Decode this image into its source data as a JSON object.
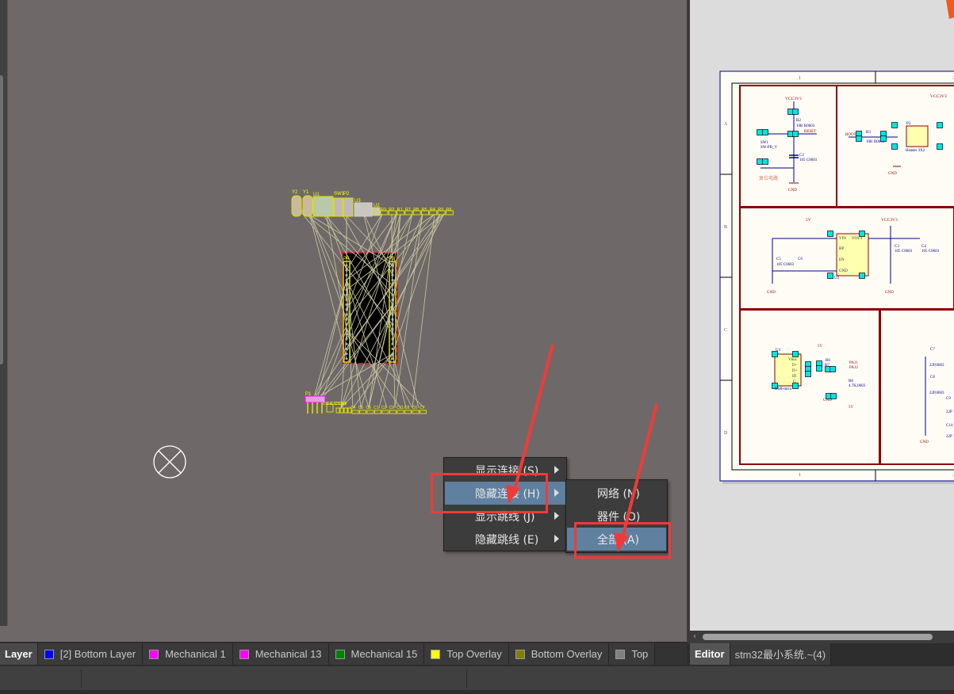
{
  "pcb": {
    "top_components": [
      "Y2",
      "Y1",
      "U1",
      "SW1",
      "P2",
      "U3",
      "U2",
      "R3",
      "R2",
      "R1",
      "R7",
      "R8",
      "R5",
      "R4",
      "R9",
      "R6"
    ],
    "main_headers": [
      "P4",
      "P3"
    ],
    "bottom_components": [
      "P1",
      "D1",
      "D2",
      "C12",
      "C13",
      "C14",
      "L2",
      "C4",
      "C5",
      "C3",
      "C1",
      "C2",
      "C9",
      "C11",
      "C8",
      "C6",
      "C7"
    ],
    "origin_marker_icon": "crosshair-circle-icon"
  },
  "context_menu": {
    "items": [
      {
        "label": "显示连接 (S)",
        "has_submenu": true
      },
      {
        "label": "隐藏连接 (H)",
        "has_submenu": true,
        "highlighted": true
      },
      {
        "label": "显示跳线 (J)",
        "has_submenu": true
      },
      {
        "label": "隐藏跳线 (E)",
        "has_submenu": true
      }
    ],
    "submenu": [
      {
        "label": "网络 (N)"
      },
      {
        "label": "器件 (O)"
      },
      {
        "label": "全部 (A)",
        "highlighted": true
      }
    ]
  },
  "annotation_color": "#f03a3a",
  "layer_tabs": [
    {
      "label": "Layer",
      "selected": true
    },
    {
      "label": "[2] Bottom Layer",
      "color": "#0000ff"
    },
    {
      "label": "Mechanical 1",
      "color": "#ff00ff"
    },
    {
      "label": "Mechanical 13",
      "color": "#ff00ff"
    },
    {
      "label": "Mechanical 15",
      "color": "#008000"
    },
    {
      "label": "Top Overlay",
      "color": "#ffff00"
    },
    {
      "label": "Bottom Overlay",
      "color": "#808000"
    },
    {
      "label": "Top",
      "color": "#808080"
    }
  ],
  "editor_tabs": [
    {
      "label": "Editor",
      "active": true
    },
    {
      "label": "stm32最小系统.~(4)"
    }
  ],
  "schematic": {
    "col_labels": [
      "1",
      "2"
    ],
    "row_labels": [
      "A",
      "B",
      "C",
      "D"
    ],
    "labels": {
      "vcc1": "VCC3V3",
      "r2": "R2",
      "r2v": "10K R0603",
      "reset": "RESET",
      "sw1": "SW1",
      "sw1v": "SW-PB_V",
      "c2": "C2",
      "c2v": "105 C0603",
      "gnd": "GND",
      "reset_circuit": "复位电路",
      "boot": "BOOT",
      "r3": "R3",
      "r3v": "10K R0603",
      "p2": "P2",
      "p2v": "Header 3X2",
      "v5": "5V",
      "vin": "VIN",
      "vout": "VOUT",
      "bp": "BP",
      "en": "EN",
      "ugnd": "GND",
      "u2": "U2",
      "c3": "C3",
      "c4": "C4",
      "c5": "C5",
      "c6": "C6",
      "cval": "105 C0603",
      "u3": "U3",
      "vbus": "Vbus",
      "dm": "D-",
      "dp": "D+",
      "id": "ID",
      "g": "G",
      "usb": "USB-mico",
      "r6": "R6",
      "r7": "R7",
      "pa11": "PA11",
      "pa12": "PA12",
      "r8": "R8",
      "r8v": "4.7K,0603",
      "c7": "C7",
      "c8": "C8",
      "c9": "C9",
      "c14": "C14",
      "c22": "22P,0603",
      "c22s": "22P"
    }
  }
}
